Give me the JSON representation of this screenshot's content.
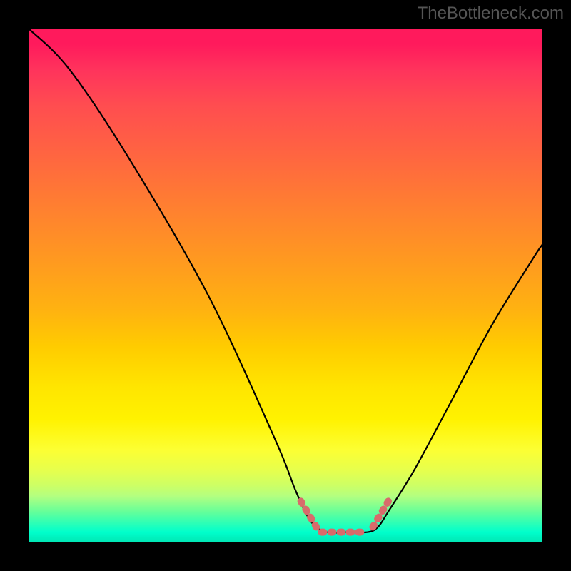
{
  "watermark": "TheBottleneck.com",
  "chart_data": {
    "type": "line",
    "title": "",
    "xlabel": "",
    "ylabel": "",
    "xlim": [
      0,
      100
    ],
    "ylim": [
      0,
      100
    ],
    "series": [
      {
        "name": "curve",
        "color": "#000000",
        "points": [
          {
            "x": 0,
            "y": 100
          },
          {
            "x": 8,
            "y": 92
          },
          {
            "x": 20,
            "y": 74
          },
          {
            "x": 35,
            "y": 48
          },
          {
            "x": 48,
            "y": 20
          },
          {
            "x": 52,
            "y": 10
          },
          {
            "x": 55,
            "y": 4
          },
          {
            "x": 58,
            "y": 2
          },
          {
            "x": 62,
            "y": 2
          },
          {
            "x": 66,
            "y": 2
          },
          {
            "x": 68,
            "y": 3
          },
          {
            "x": 70,
            "y": 6
          },
          {
            "x": 75,
            "y": 14
          },
          {
            "x": 82,
            "y": 27
          },
          {
            "x": 90,
            "y": 42
          },
          {
            "x": 98,
            "y": 55
          },
          {
            "x": 100,
            "y": 58
          }
        ]
      },
      {
        "name": "highlight",
        "color": "#d86b6b",
        "stroke_width_px": 10,
        "segments": [
          [
            {
              "x": 53,
              "y": 8
            },
            {
              "x": 56,
              "y": 3
            }
          ],
          [
            {
              "x": 57,
              "y": 2
            },
            {
              "x": 66,
              "y": 2
            }
          ],
          [
            {
              "x": 67,
              "y": 3
            },
            {
              "x": 70,
              "y": 8
            }
          ]
        ]
      }
    ],
    "gradient": {
      "direction": "vertical",
      "stops": [
        {
          "pos": 0,
          "color": "#ff1a5c"
        },
        {
          "pos": 50,
          "color": "#ffb300"
        },
        {
          "pos": 75,
          "color": "#ffff00"
        },
        {
          "pos": 100,
          "color": "#00e6b3"
        }
      ]
    }
  }
}
